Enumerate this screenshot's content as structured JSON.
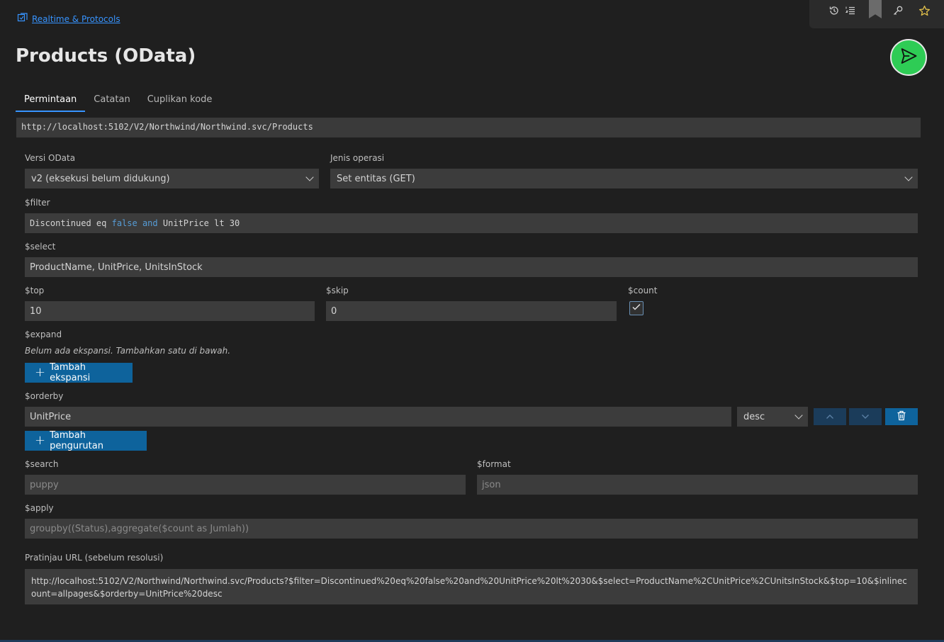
{
  "breadcrumb": {
    "label": "Realtime & Protocols"
  },
  "page": {
    "title": "Products (OData)"
  },
  "tabs": [
    {
      "label": "Permintaan",
      "active": true
    },
    {
      "label": "Catatan",
      "active": false
    },
    {
      "label": "Cuplikan kode",
      "active": false
    }
  ],
  "url": {
    "value": "http://localhost:5102/V2/Northwind/Northwind.svc/Products"
  },
  "odata_version": {
    "label": "Versi OData",
    "value": "v2 (eksekusi belum didukung)"
  },
  "operation": {
    "label": "Jenis operasi",
    "value": "Set entitas (GET)"
  },
  "filter": {
    "label": "$filter",
    "t1": "Discontinued eq ",
    "t2": "false",
    "t3": " ",
    "t4": "and",
    "t5": " UnitPrice lt 30"
  },
  "select": {
    "label": "$select",
    "value": "ProductName, UnitPrice, UnitsInStock"
  },
  "top": {
    "label": "$top",
    "value": "10"
  },
  "skip": {
    "label": "$skip",
    "value": "0"
  },
  "count": {
    "label": "$count",
    "checked": true
  },
  "expand": {
    "label": "$expand",
    "empty_text": "Belum ada ekspansi. Tambahkan satu di bawah.",
    "add_label": "Tambah ekspansi"
  },
  "orderby": {
    "label": "$orderby",
    "field": "UnitPrice",
    "direction": "desc",
    "add_label": "Tambah pengurutan"
  },
  "search": {
    "label": "$search",
    "placeholder": "puppy"
  },
  "format": {
    "label": "$format",
    "placeholder": "json"
  },
  "apply": {
    "label": "$apply",
    "placeholder": "groupby((Status),aggregate($count as Jumlah))"
  },
  "preview": {
    "label": "Pratinjau URL (sebelum resolusi)",
    "value": "http://localhost:5102/V2/Northwind/Northwind.svc/Products?$filter=Discontinued%20eq%20false%20and%20UnitPrice%20lt%2030&$select=ProductName%2CUnitPrice%2CUnitsInStock&$top=10&$inlinecount=allpages&$orderby=UnitPrice%20desc"
  },
  "icons": {
    "history": "history-icon",
    "list": "list-icon",
    "bookmark": "bookmark-icon",
    "key": "key-icon",
    "star": "star-icon",
    "send": "send-icon"
  },
  "colors": {
    "accent": "#0e639c",
    "send_button": "#2ecc55",
    "keyword": "#569cd6",
    "link": "#3794ff"
  }
}
